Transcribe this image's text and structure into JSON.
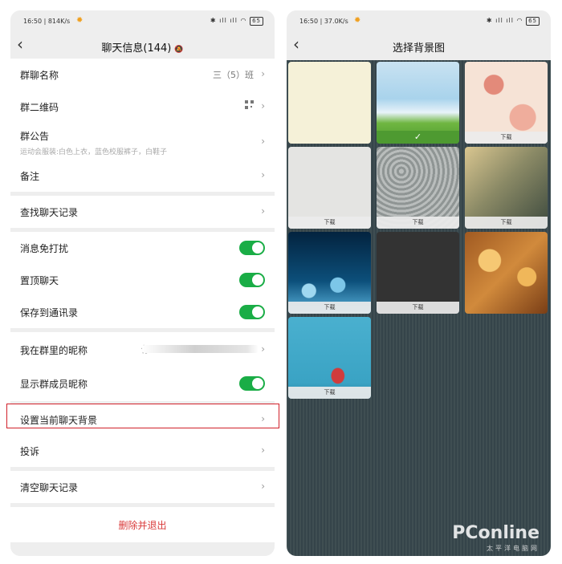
{
  "left": {
    "status": {
      "time": "16:50",
      "speed": "814K/s",
      "battery": "65"
    },
    "nav": {
      "title": "聊天信息(144)"
    },
    "rows": {
      "group_name": "群聊名称",
      "group_name_value": "三（5）班",
      "qr": "群二维码",
      "notice": "群公告",
      "notice_sub": "运动会服装:白色上衣，蓝色校服裤子，白鞋子",
      "remark": "备注",
      "search": "查找聊天记录",
      "mute": "消息免打扰",
      "pin": "置顶聊天",
      "save": "保存到通讯录",
      "nickname": "我在群里的昵称",
      "nickname_value": "仔",
      "show_nick": "显示群成员昵称",
      "background": "设置当前聊天背景",
      "complain": "投诉",
      "clear": "清空聊天记录",
      "delete": "删除并退出"
    },
    "toggles": {
      "mute": true,
      "pin": true,
      "save": true,
      "show_nick": true
    }
  },
  "right": {
    "status": {
      "time": "16:50",
      "speed": "37.0K/s",
      "battery": "65"
    },
    "nav": {
      "title": "选择背景图"
    },
    "download_label": "下载",
    "selected_mark": "✓"
  },
  "watermark": {
    "brand": "PConline",
    "sub": "太平洋电脑网"
  },
  "colors": {
    "toggle_on": "#1aad46",
    "danger": "#d93a3a",
    "highlight": "#d0202a"
  }
}
